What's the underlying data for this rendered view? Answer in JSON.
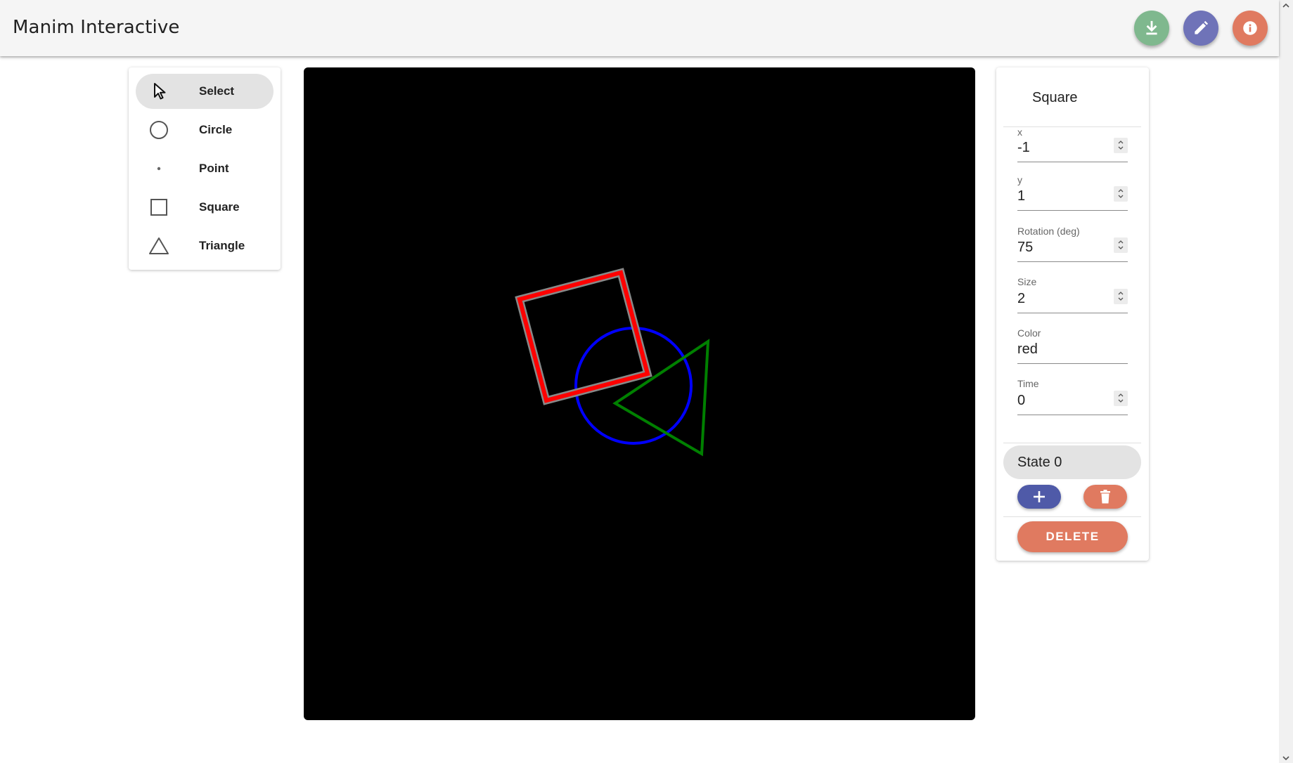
{
  "app": {
    "title": "Manim Interactive"
  },
  "toolbar": {
    "actions": [
      {
        "icon": "download-icon",
        "color": "#7fb88e"
      },
      {
        "icon": "pencil-icon",
        "color": "#6f73b8"
      },
      {
        "icon": "info-icon",
        "color": "#e07a60"
      }
    ]
  },
  "tools": {
    "items": [
      {
        "label": "Select",
        "icon": "cursor-icon",
        "selected": true
      },
      {
        "label": "Circle",
        "icon": "circle-icon",
        "selected": false
      },
      {
        "label": "Point",
        "icon": "point-icon",
        "selected": false
      },
      {
        "label": "Square",
        "icon": "square-icon",
        "selected": false
      },
      {
        "label": "Triangle",
        "icon": "triangle-icon",
        "selected": false
      }
    ]
  },
  "scene": {
    "background": "#000000",
    "shapes": [
      {
        "type": "circle",
        "color": "#0000ff"
      },
      {
        "type": "triangle",
        "color": "#008000"
      },
      {
        "type": "square",
        "color": "#ff0000",
        "selected": true
      }
    ]
  },
  "properties": {
    "title": "Square",
    "fields": [
      {
        "label": "x",
        "value": "-1",
        "spinner": true
      },
      {
        "label": "y",
        "value": "1",
        "spinner": true
      },
      {
        "label": "Rotation (deg)",
        "value": "75",
        "spinner": true
      },
      {
        "label": "Size",
        "value": "2",
        "spinner": true
      },
      {
        "label": "Color",
        "value": "red",
        "spinner": false
      },
      {
        "label": "Time",
        "value": "0",
        "spinner": true
      }
    ],
    "state_label": "State 0",
    "add_state_color": "#4f5aa8",
    "delete_state_color": "#e07a60",
    "delete_label": "DELETE"
  }
}
